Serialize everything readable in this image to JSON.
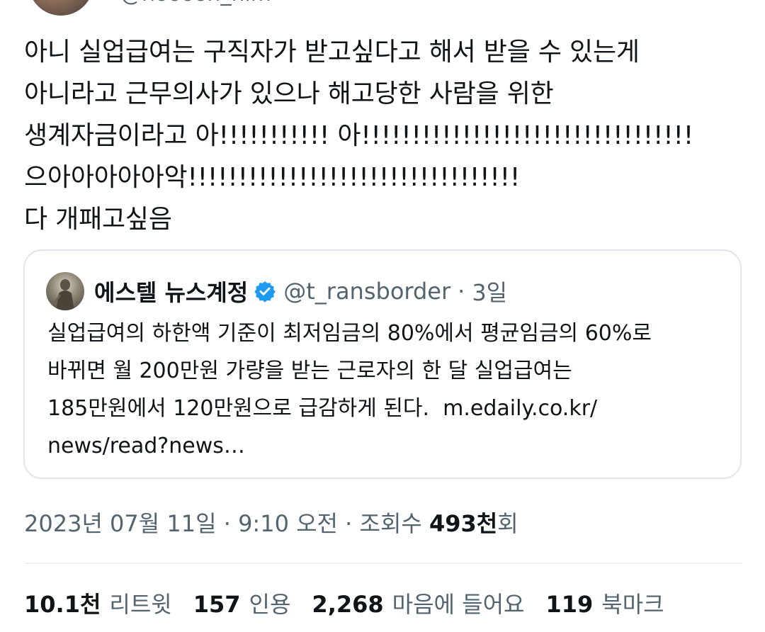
{
  "author": {
    "handle": "@hooooh_him"
  },
  "tweet": {
    "lines": [
      "아니 실업급여는 구직자가 받고싶다고 해서 받을 수 있는게",
      "아니라고 근무의사가 있으나 해고당한 사람을 위한",
      "생계자금이라고 아!!!!!!!!!!! 아!!!!!!!!!!!!!!!!!!!!!!!!!!!!!!!!!",
      "으아아아아아악!!!!!!!!!!!!!!!!!!!!!!!!!!!!!!!!!",
      "다 개패고싶음"
    ]
  },
  "quote": {
    "name": "에스텔 뉴스계정",
    "handle": "@t_ransborder",
    "separator": "·",
    "time": "3일",
    "lines": [
      "실업급여의 하한액 기준이 최저임금의 80%에서 평균임금의 60%로",
      "바뀌면 월 200만원 가량을 받는 근로자의 한 달 실업급여는",
      "185만원에서 120만원으로 급감하게 된다."
    ],
    "link_part1": "m.edaily.co.kr/",
    "link_part2": "news/read?news…",
    "verified_color": "#1d9bf0"
  },
  "meta": {
    "date": "2023년 07월 11일",
    "sep1": "·",
    "time": "9:10 오전",
    "sep2": "·",
    "views_label": "조회수",
    "views_num": "493천",
    "views_suffix": "회"
  },
  "stats": {
    "retweets_num": "10.1천",
    "retweets_label": "리트윗",
    "quotes_num": "157",
    "quotes_label": "인용",
    "likes_num": "2,268",
    "likes_label": "마음에 들어요",
    "bookmarks_num": "119",
    "bookmarks_label": "북마크"
  }
}
